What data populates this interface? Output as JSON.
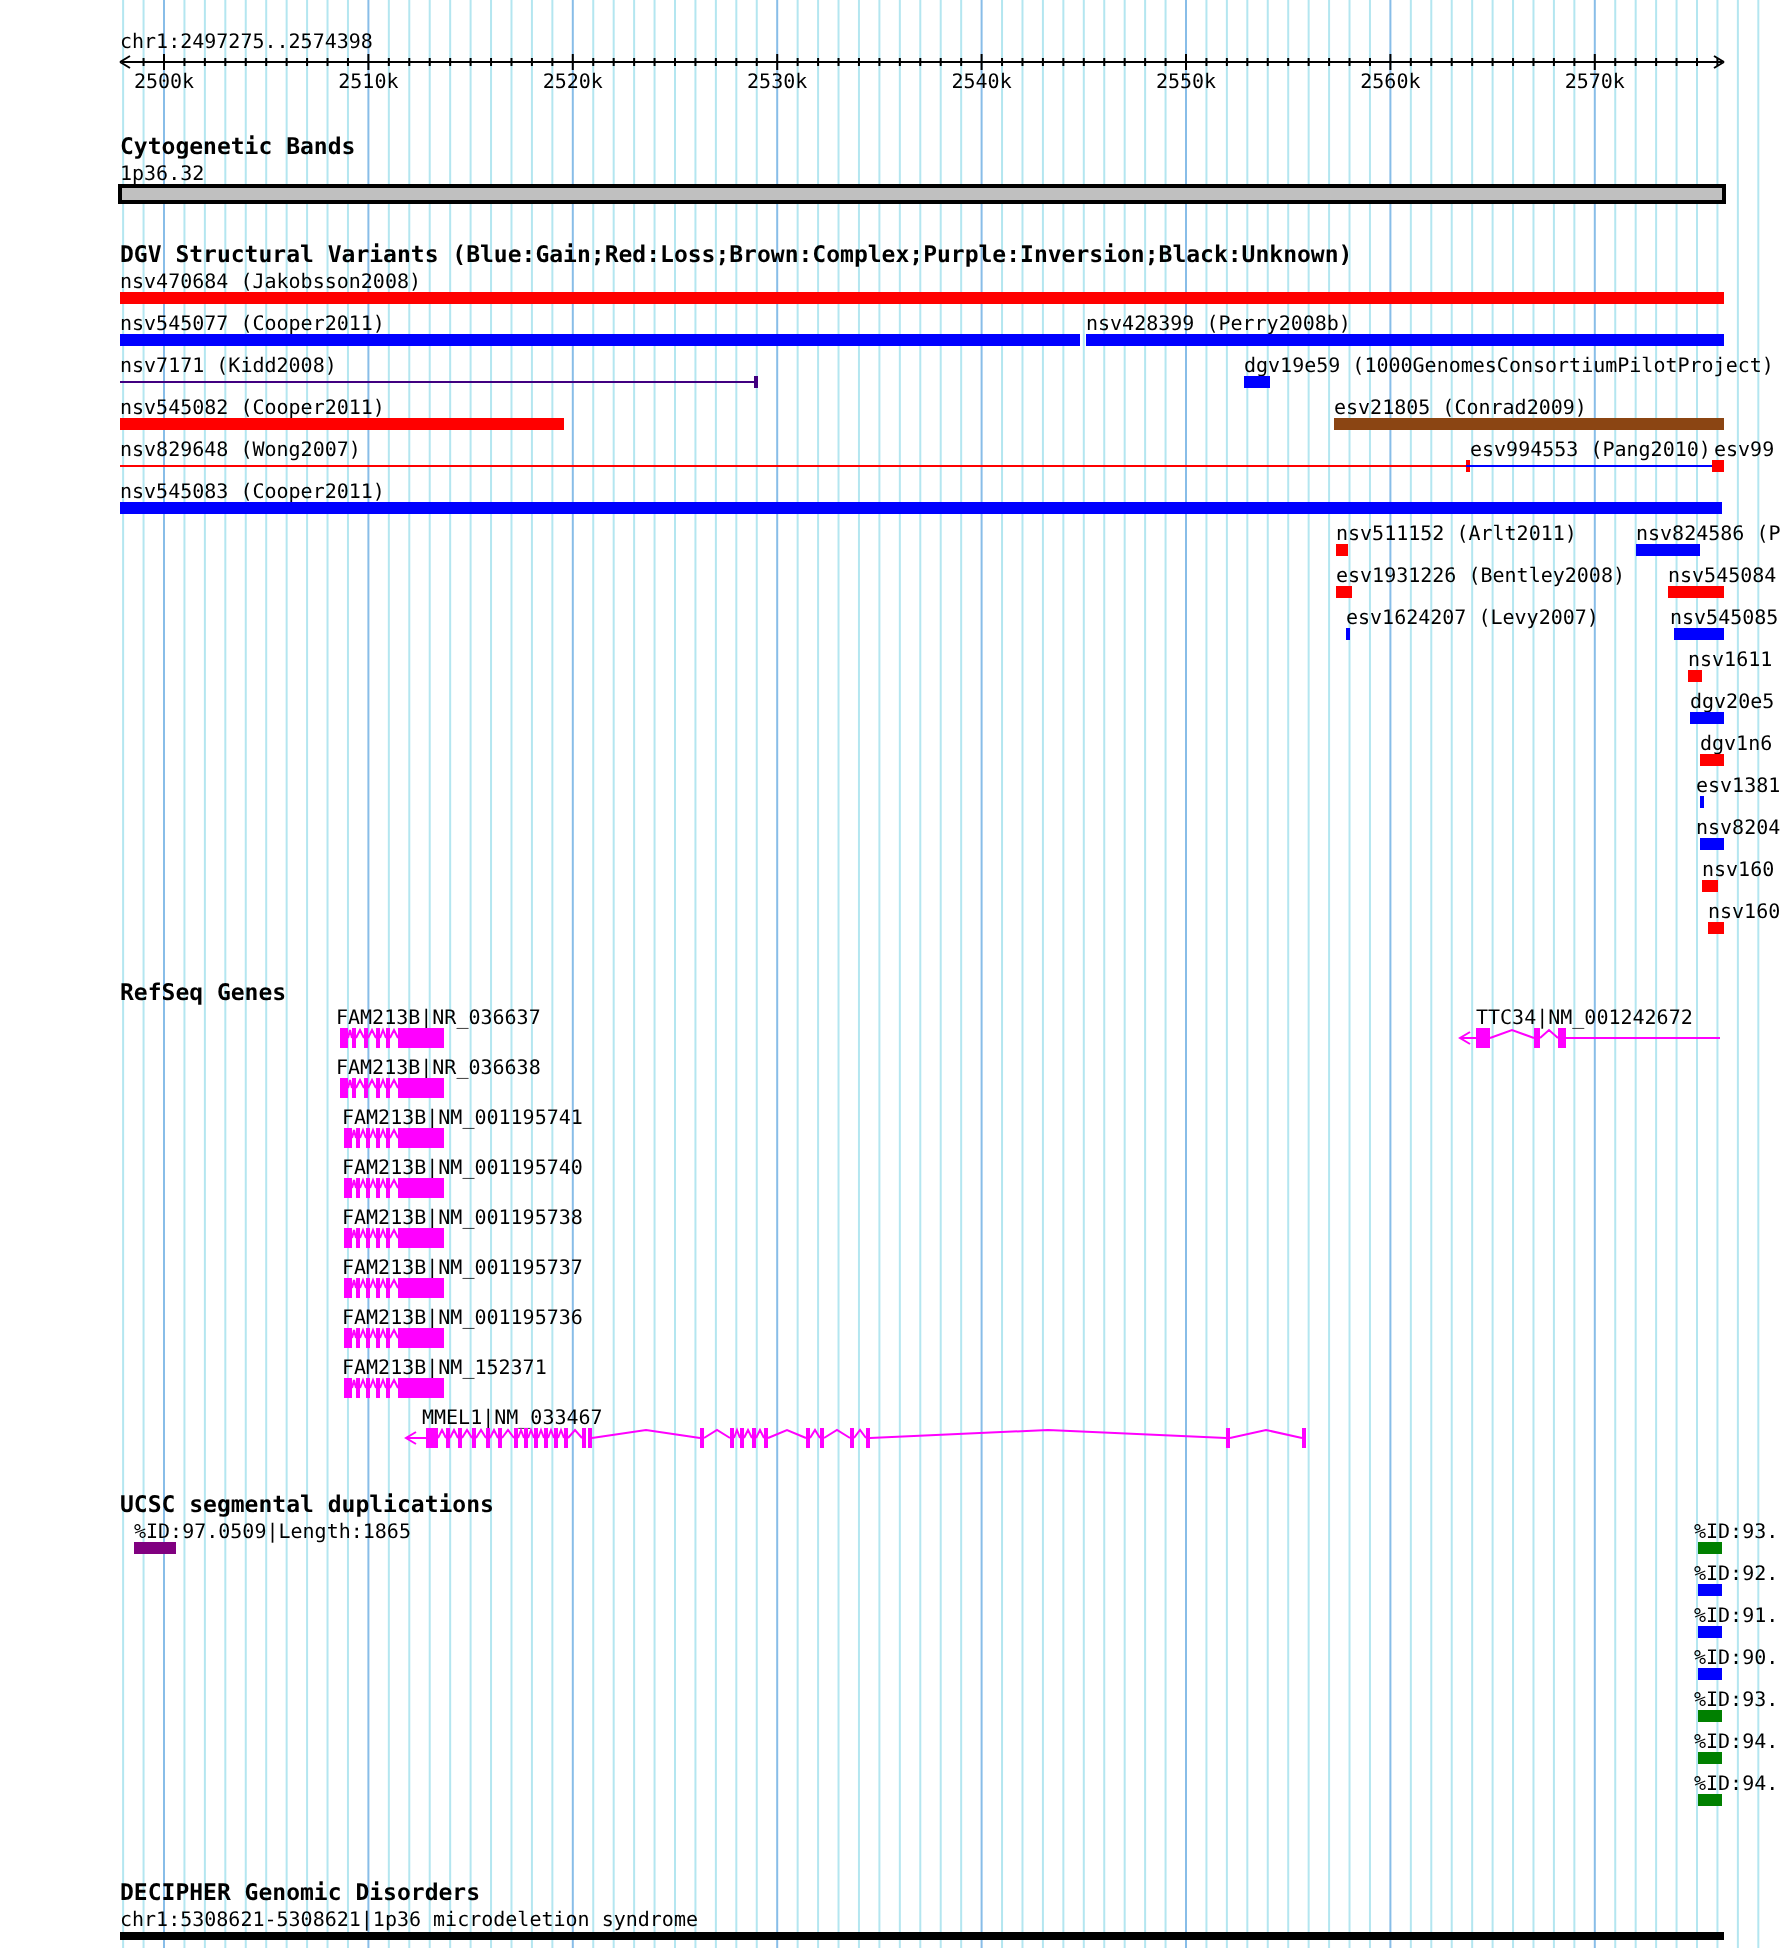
{
  "ruler": {
    "range": "chr1:2497275..2574398",
    "ticks": [
      "2500k",
      "2510k",
      "2520k",
      "2530k",
      "2540k",
      "2550k",
      "2560k",
      "2570k"
    ]
  },
  "tracks": [
    {
      "kind": "cytoband",
      "title": "Cytogenetic Bands",
      "features": [
        {
          "label": "1p36.32",
          "color": "#c0c0c0"
        }
      ]
    },
    {
      "kind": "variants",
      "title": "DGV Structural Variants (Blue:Gain;Red:Loss;Brown:Complex;Purple:Inversion;Black:Unknown)",
      "features": [
        {
          "label": "nsv470684 (Jakobsson2008)",
          "kind": "bar",
          "color": "#ff0000"
        },
        {
          "label": "nsv545077 (Cooper2011)",
          "kind": "bar",
          "color": "#0000ff"
        },
        {
          "label": "nsv428399 (Perry2008b)",
          "kind": "bar",
          "color": "#0000ff"
        },
        {
          "label": "nsv7171 (Kidd2008)",
          "kind": "line",
          "color": "#400080"
        },
        {
          "label": "dgv19e59 (1000GenomesConsortiumPilotProject)",
          "kind": "bar",
          "color": "#0000ff"
        },
        {
          "label": "nsv545082 (Cooper2011)",
          "kind": "bar",
          "color": "#ff0000"
        },
        {
          "label": "esv21805 (Conrad2009)",
          "kind": "bar",
          "color": "#8b4513"
        },
        {
          "label": "nsv829648 (Wong2007)",
          "kind": "line",
          "color": "#ff0000"
        },
        {
          "label": "esv994553 (Pang2010)",
          "kind": "line",
          "color": "#0000ff"
        },
        {
          "label": "esv99",
          "kind": "bar",
          "color": "#ff0000"
        },
        {
          "label": "nsv545083 (Cooper2011)",
          "kind": "bar",
          "color": "#0000ff"
        },
        {
          "label": "nsv511152 (Arlt2011)",
          "kind": "bar",
          "color": "#ff0000"
        },
        {
          "label": "nsv824586 (P",
          "kind": "bar",
          "color": "#0000ff"
        },
        {
          "label": "esv1931226 (Bentley2008)",
          "kind": "bar",
          "color": "#ff0000"
        },
        {
          "label": "nsv545084",
          "kind": "bar",
          "color": "#ff0000"
        },
        {
          "label": "esv1624207 (Levy2007)",
          "kind": "bar",
          "color": "#0000ff"
        },
        {
          "label": "nsv545085",
          "kind": "bar",
          "color": "#0000ff"
        },
        {
          "label": "nsv1611",
          "kind": "bar",
          "color": "#ff0000"
        },
        {
          "label": "dgv20e5",
          "kind": "bar",
          "color": "#0000ff"
        },
        {
          "label": "dgv1n6",
          "kind": "bar",
          "color": "#ff0000"
        },
        {
          "label": "esv1381",
          "kind": "bar",
          "color": "#0000ff"
        },
        {
          "label": "nsv8204",
          "kind": "bar",
          "color": "#0000ff"
        },
        {
          "label": "nsv160",
          "kind": "bar",
          "color": "#ff0000"
        },
        {
          "label": "nsv160",
          "kind": "bar",
          "color": "#ff0000"
        }
      ]
    },
    {
      "kind": "genes",
      "title": "RefSeq Genes",
      "features": [
        {
          "label": "FAM213B|NR_036637"
        },
        {
          "label": "TTC34|NM_001242672"
        },
        {
          "label": "FAM213B|NR_036638"
        },
        {
          "label": "FAM213B|NM_001195741"
        },
        {
          "label": "FAM213B|NM_001195740"
        },
        {
          "label": "FAM213B|NM_001195738"
        },
        {
          "label": "FAM213B|NM_001195737"
        },
        {
          "label": "FAM213B|NM_001195736"
        },
        {
          "label": "FAM213B|NM_152371"
        },
        {
          "label": "MMEL1|NM_033467"
        }
      ]
    },
    {
      "kind": "segdups",
      "title": "UCSC segmental duplications",
      "features": [
        {
          "label": "%ID:97.0509|Length:1865",
          "color": "#800080"
        },
        {
          "label": "%ID:93.",
          "color": "#008000"
        },
        {
          "label": "%ID:92.",
          "color": "#0000ff"
        },
        {
          "label": "%ID:91.",
          "color": "#0000ff"
        },
        {
          "label": "%ID:90.",
          "color": "#0000ff"
        },
        {
          "label": "%ID:93.",
          "color": "#008000"
        },
        {
          "label": "%ID:94.",
          "color": "#008000"
        },
        {
          "label": "%ID:94.",
          "color": "#008000"
        }
      ]
    },
    {
      "kind": "disorders",
      "title": "DECIPHER Genomic Disorders",
      "features": [
        {
          "label": "chr1:5308621-5308621|1p36 microdeletion syndrome",
          "color": "#000000"
        }
      ]
    }
  ]
}
